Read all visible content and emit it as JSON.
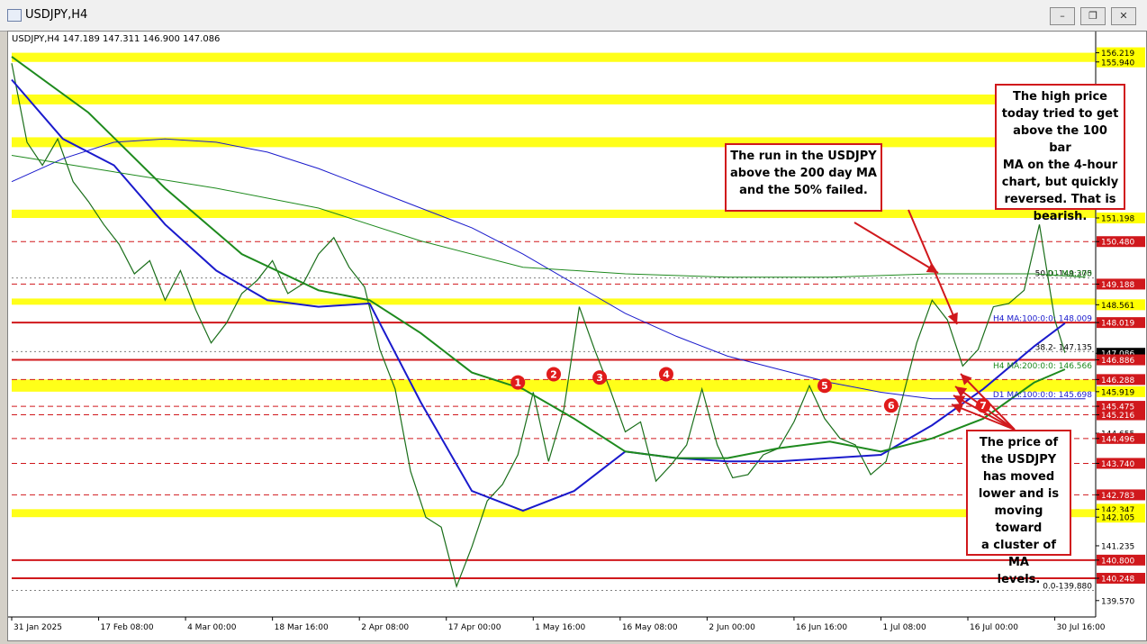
{
  "window": {
    "title": "USDJPY,H4",
    "buttons": [
      "minimize",
      "restore",
      "close"
    ]
  },
  "chart_data": {
    "type": "line",
    "header": "USDJPY,H4  147.189 147.311 146.900 147.086",
    "x_tick_labels": [
      "31 Jan 2025",
      "17 Feb 08:00",
      "4 Mar 00:00",
      "18 Mar 16:00",
      "2 Apr 08:00",
      "17 Apr 00:00",
      "1 May 16:00",
      "16 May 08:00",
      "2 Jun 00:00",
      "16 Jun 16:00",
      "1 Jul 08:00",
      "16 Jul 00:00",
      "30 Jul 16:00"
    ],
    "x_tick_positions": [
      0,
      17,
      34,
      51,
      68,
      85,
      102,
      119,
      136,
      153,
      170,
      187,
      204
    ],
    "x_range": [
      0,
      212
    ],
    "y_range": [
      139.4,
      156.7
    ],
    "price_labels": [
      156.219,
      155.94,
      151.198,
      150.48,
      149.188,
      148.561,
      148.019,
      147.086,
      146.886,
      146.288,
      145.919,
      145.475,
      145.216,
      144.655,
      144.496,
      143.74,
      142.783,
      142.347,
      142.105,
      141.235,
      140.8,
      140.248,
      139.57
    ],
    "current_price": 147.086,
    "yellow_zones": [
      {
        "low": 155.94,
        "high": 156.219
      },
      {
        "low": 154.65,
        "high": 154.95
      },
      {
        "low": 153.35,
        "high": 153.65
      },
      {
        "low": 151.198,
        "high": 151.45
      },
      {
        "low": 148.561,
        "high": 148.75
      },
      {
        "low": 145.919,
        "high": 146.288
      },
      {
        "low": 142.105,
        "high": 142.347
      }
    ],
    "red_lines": [
      {
        "price": 148.019,
        "dashed": false
      },
      {
        "price": 146.886,
        "dashed": false
      },
      {
        "price": 140.8,
        "dashed": false
      },
      {
        "price": 140.248,
        "dashed": false
      },
      {
        "price": 150.48,
        "dashed": true
      },
      {
        "price": 149.188,
        "dashed": true
      },
      {
        "price": 146.288,
        "dashed": true
      },
      {
        "price": 145.475,
        "dashed": true
      },
      {
        "price": 145.216,
        "dashed": true
      },
      {
        "price": 144.496,
        "dashed": true
      },
      {
        "price": 143.74,
        "dashed": true
      },
      {
        "price": 142.783,
        "dashed": true
      }
    ],
    "fib_lines": [
      {
        "price": 149.375,
        "label": "50.0 -149.375"
      },
      {
        "price": 147.135,
        "label": "38.2- 147.135"
      },
      {
        "price": 139.88,
        "label": "0.0-139.880"
      }
    ],
    "ma_labels": [
      {
        "text": "D1 MA:200",
        "price": 149.375,
        "color": "#1e8a1e"
      },
      {
        "text": "H4 MA:100:0:0: 148.009",
        "price": 148.009,
        "color": "#1a1acc"
      },
      {
        "text": "H4 MA:200:0:0: 146.566",
        "price": 146.566,
        "color": "#1e8a1e"
      },
      {
        "text": "D1 MA:100:0:0: 145.698",
        "price": 145.698,
        "color": "#1a1acc"
      }
    ],
    "price_series": {
      "x": [
        0,
        3,
        6,
        9,
        12,
        15,
        18,
        21,
        24,
        27,
        30,
        33,
        36,
        39,
        42,
        45,
        48,
        51,
        54,
        57,
        60,
        63,
        66,
        69,
        72,
        75,
        78,
        81,
        84,
        87,
        90,
        93,
        96,
        99,
        102,
        105,
        108,
        111,
        114,
        117,
        120,
        123,
        126,
        129,
        132,
        135,
        138,
        141,
        144,
        147,
        150,
        153,
        156,
        159,
        162,
        165,
        168,
        171,
        174,
        177,
        180,
        183,
        186,
        189,
        192,
        195,
        198,
        201,
        204,
        206
      ],
      "y": [
        155.9,
        153.5,
        152.8,
        153.6,
        152.3,
        151.7,
        151.0,
        150.4,
        149.5,
        149.9,
        148.7,
        149.6,
        148.4,
        147.4,
        148.0,
        148.9,
        149.3,
        149.9,
        148.9,
        149.2,
        150.1,
        150.6,
        149.7,
        149.1,
        147.2,
        146.0,
        143.5,
        142.1,
        141.8,
        140.0,
        141.2,
        142.6,
        143.1,
        144.0,
        145.9,
        143.8,
        145.4,
        148.5,
        147.2,
        146.0,
        144.7,
        145.0,
        143.2,
        143.7,
        144.3,
        146.0,
        144.3,
        143.3,
        143.4,
        144.0,
        144.2,
        145.0,
        146.1,
        145.1,
        144.5,
        144.3,
        143.4,
        143.8,
        145.6,
        147.4,
        148.7,
        148.1,
        146.7,
        147.2,
        148.5,
        148.6,
        149.0,
        151.0,
        148.1,
        147.1
      ]
    },
    "series": [
      {
        "color": "#1a1acc",
        "width": 2,
        "x": [
          0,
          10,
          20,
          30,
          40,
          50,
          60,
          70,
          80,
          90,
          100,
          110,
          120,
          130,
          140,
          150,
          160,
          170,
          180,
          190,
          200,
          206
        ],
        "y": [
          155.4,
          153.6,
          152.8,
          151.0,
          149.6,
          148.7,
          148.5,
          148.6,
          145.6,
          142.9,
          142.3,
          142.9,
          144.1,
          143.9,
          143.8,
          143.8,
          143.9,
          144.0,
          144.9,
          146.0,
          147.3,
          148.0
        ]
      },
      {
        "color": "#1e8a1e",
        "width": 2,
        "x": [
          0,
          15,
          30,
          45,
          60,
          70,
          80,
          90,
          100,
          110,
          120,
          130,
          140,
          150,
          160,
          170,
          180,
          190,
          200,
          206
        ],
        "y": [
          156.1,
          154.4,
          152.1,
          150.1,
          149.0,
          148.7,
          147.7,
          146.5,
          146.0,
          145.1,
          144.1,
          143.9,
          143.9,
          144.2,
          144.4,
          144.1,
          144.5,
          145.1,
          146.2,
          146.6
        ]
      },
      {
        "color": "#1a1acc",
        "width": 1,
        "x": [
          0,
          10,
          20,
          30,
          40,
          50,
          60,
          70,
          80,
          90,
          100,
          110,
          120,
          130,
          140,
          150,
          160,
          170,
          180,
          190,
          200,
          210
        ],
        "y": [
          152.3,
          153.0,
          153.5,
          153.6,
          153.5,
          153.2,
          152.7,
          152.1,
          151.5,
          150.9,
          150.1,
          149.2,
          148.3,
          147.6,
          147.0,
          146.6,
          146.2,
          145.9,
          145.7,
          145.7,
          145.7,
          145.7
        ]
      },
      {
        "color": "#1e8a1e",
        "width": 1,
        "x": [
          0,
          20,
          40,
          60,
          80,
          100,
          120,
          140,
          160,
          180,
          200,
          210
        ],
        "y": [
          153.1,
          152.6,
          152.1,
          151.5,
          150.5,
          149.7,
          149.5,
          149.4,
          149.4,
          149.5,
          149.5,
          149.4
        ]
      }
    ],
    "markers": [
      {
        "label": "1",
        "x": 99,
        "y": 146.2
      },
      {
        "label": "2",
        "x": 106,
        "y": 146.45
      },
      {
        "label": "3",
        "x": 115,
        "y": 146.35
      },
      {
        "label": "4",
        "x": 128,
        "y": 146.45
      },
      {
        "label": "5",
        "x": 159,
        "y": 146.1
      },
      {
        "label": "6",
        "x": 172,
        "y": 145.5
      },
      {
        "label": "7",
        "x": 190,
        "y": 145.5
      }
    ]
  },
  "annotations": {
    "callout_high": "The high price\ntoday tried to get\nabove the 100 bar\nMA on the 4-hour\nchart, but quickly\nreversed. That is\nbearish.",
    "callout_200day": "The run in the USDJPY\nabove the 200 day MA\nand the 50% failed.",
    "callout_cluster": "The price of\nthe USDJPY\nhas moved\nlower and is\nmoving toward\na cluster of MA\nlevels."
  }
}
